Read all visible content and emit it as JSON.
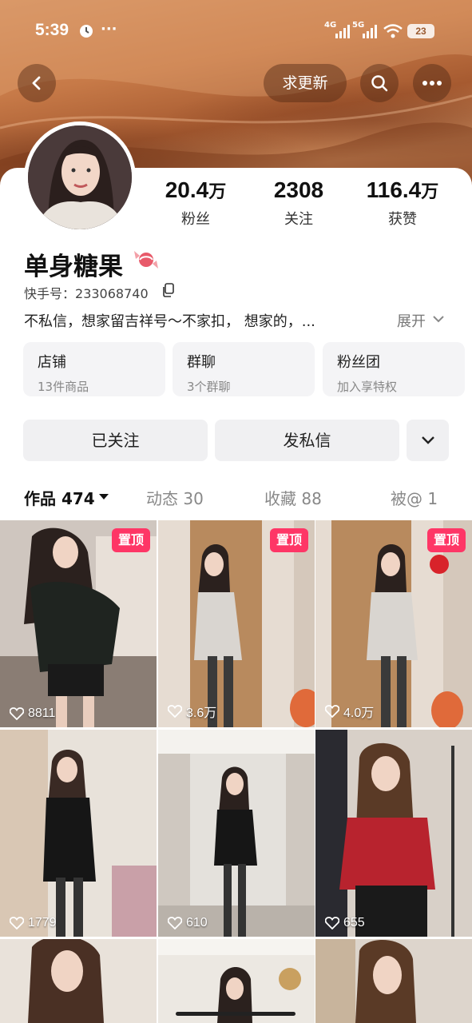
{
  "status_bar": {
    "time": "5:39",
    "signal_1": "4G",
    "signal_2": "5G",
    "battery": "23"
  },
  "header": {
    "request_update_label": "求更新"
  },
  "profile": {
    "stats": [
      {
        "num": "20.4",
        "unit": "万",
        "label": "粉丝"
      },
      {
        "num": "2308",
        "unit": "",
        "label": "关注"
      },
      {
        "num": "116.4",
        "unit": "万",
        "label": "获赞"
      }
    ],
    "nickname": "单身糖果",
    "uid_label": "快手号：",
    "uid": "233068740",
    "bio": "不私信，想家留吉祥号～不家扣， 想家的，...",
    "expand_label": "展开"
  },
  "features": [
    {
      "title": "店铺",
      "sub": "13件商品"
    },
    {
      "title": "群聊",
      "sub": "3个群聊"
    },
    {
      "title": "粉丝团",
      "sub": "加入享特权"
    }
  ],
  "actions": {
    "followed_label": "已关注",
    "message_label": "发私信"
  },
  "tabs": [
    {
      "label": "作品 474"
    },
    {
      "label": "动态 30"
    },
    {
      "label": "收藏 88"
    },
    {
      "label": "被@ 1"
    }
  ],
  "grid": {
    "pin_label": "置顶",
    "items": [
      {
        "likes": "8811",
        "pinned": true
      },
      {
        "likes": "3.6万",
        "pinned": true
      },
      {
        "likes": "4.0万",
        "pinned": true
      },
      {
        "likes": "1779",
        "pinned": false
      },
      {
        "likes": "610",
        "pinned": false
      },
      {
        "likes": "655",
        "pinned": false
      }
    ]
  },
  "colors": {
    "pin": "#fe3666",
    "banner": "#c77a48",
    "button_bg": "#f0f0f2"
  }
}
